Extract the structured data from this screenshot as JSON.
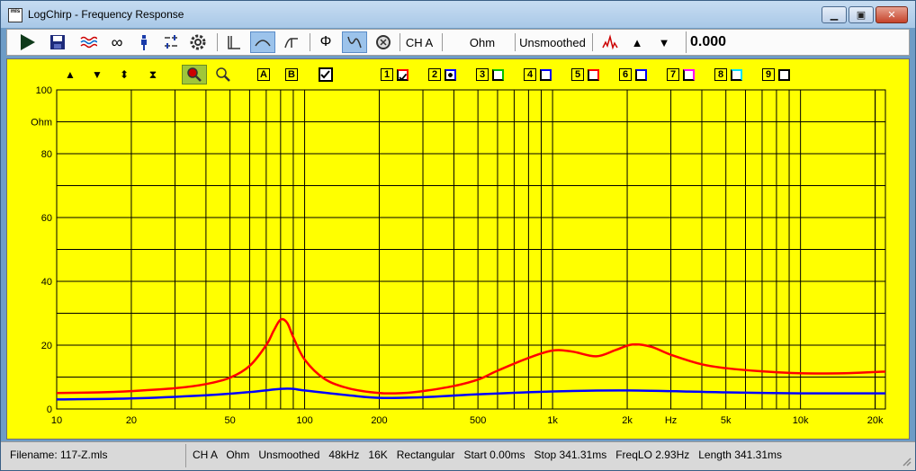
{
  "window": {
    "title": "LogChirp - Frequency Response",
    "icon_text": "mls"
  },
  "toolbar": {
    "channel": "CH A",
    "unit": "Ohm",
    "smoothing": "Unsmoothed",
    "readout": "0.000"
  },
  "plot_toolbar": {
    "marker_a": "A",
    "marker_b": "B",
    "overlays": [
      {
        "label": "1",
        "color": "#ff0000",
        "checked": true
      },
      {
        "label": "2",
        "color": "#0000ff",
        "checked": false,
        "filled": true
      },
      {
        "label": "3",
        "color": "#00c000",
        "checked": false
      },
      {
        "label": "4",
        "color": "#0000ff",
        "checked": false
      },
      {
        "label": "5",
        "color": "#ff0000",
        "checked": false
      },
      {
        "label": "6",
        "color": "#0000ff",
        "checked": false
      },
      {
        "label": "7",
        "color": "#ff00ff",
        "checked": false
      },
      {
        "label": "8",
        "color": "#00e0ff",
        "checked": false
      },
      {
        "label": "9",
        "color": "#000000",
        "checked": false
      }
    ]
  },
  "chart_data": {
    "type": "line",
    "x_scale": "log",
    "xlim": [
      10,
      22000
    ],
    "ylim": [
      0,
      100
    ],
    "y_unit_label": "Ohm",
    "x_unit_label": "Hz",
    "y_ticks": [
      0,
      20,
      40,
      60,
      80,
      100
    ],
    "x_tick_labels": [
      {
        "value": 10,
        "label": "10"
      },
      {
        "value": 20,
        "label": "20"
      },
      {
        "value": 50,
        "label": "50"
      },
      {
        "value": 100,
        "label": "100"
      },
      {
        "value": 200,
        "label": "200"
      },
      {
        "value": 500,
        "label": "500"
      },
      {
        "value": 1000,
        "label": "1k"
      },
      {
        "value": 2000,
        "label": "2k"
      },
      {
        "value": 5000,
        "label": "5k"
      },
      {
        "value": 10000,
        "label": "10k"
      },
      {
        "value": 20000,
        "label": "20k"
      }
    ],
    "grid": true,
    "series": [
      {
        "color": "#ff0000",
        "points": [
          [
            10,
            5.0
          ],
          [
            15,
            5.2
          ],
          [
            20,
            5.6
          ],
          [
            30,
            6.5
          ],
          [
            40,
            7.8
          ],
          [
            50,
            9.8
          ],
          [
            60,
            13.5
          ],
          [
            70,
            20.0
          ],
          [
            75,
            24.5
          ],
          [
            80,
            28.0
          ],
          [
            85,
            27.0
          ],
          [
            90,
            22.5
          ],
          [
            100,
            15.5
          ],
          [
            120,
            9.5
          ],
          [
            150,
            6.5
          ],
          [
            200,
            5.0
          ],
          [
            250,
            5.0
          ],
          [
            300,
            5.6
          ],
          [
            400,
            7.2
          ],
          [
            500,
            9.2
          ],
          [
            600,
            12.0
          ],
          [
            800,
            16.0
          ],
          [
            1000,
            18.3
          ],
          [
            1200,
            18.0
          ],
          [
            1500,
            16.5
          ],
          [
            1800,
            18.5
          ],
          [
            2100,
            20.2
          ],
          [
            2500,
            19.5
          ],
          [
            3000,
            17.0
          ],
          [
            4000,
            14.0
          ],
          [
            5000,
            12.8
          ],
          [
            7000,
            11.8
          ],
          [
            10000,
            11.2
          ],
          [
            15000,
            11.2
          ],
          [
            20000,
            11.6
          ],
          [
            22000,
            11.7
          ]
        ]
      },
      {
        "color": "#0000ff",
        "points": [
          [
            10,
            3.0
          ],
          [
            20,
            3.3
          ],
          [
            40,
            4.3
          ],
          [
            60,
            5.3
          ],
          [
            80,
            6.3
          ],
          [
            90,
            6.3
          ],
          [
            100,
            5.8
          ],
          [
            150,
            4.3
          ],
          [
            200,
            3.5
          ],
          [
            300,
            3.7
          ],
          [
            500,
            4.6
          ],
          [
            1000,
            5.5
          ],
          [
            2000,
            5.8
          ],
          [
            5000,
            5.2
          ],
          [
            10000,
            4.9
          ],
          [
            22000,
            4.9
          ]
        ]
      }
    ]
  },
  "status": {
    "filename": "Filename: 117-Z.mls",
    "info": "CH A   Ohm   Unsmoothed   48kHz   16K   Rectangular   Start 0.00ms   Stop 341.31ms   FreqLO 2.93Hz   Length 341.31ms"
  }
}
